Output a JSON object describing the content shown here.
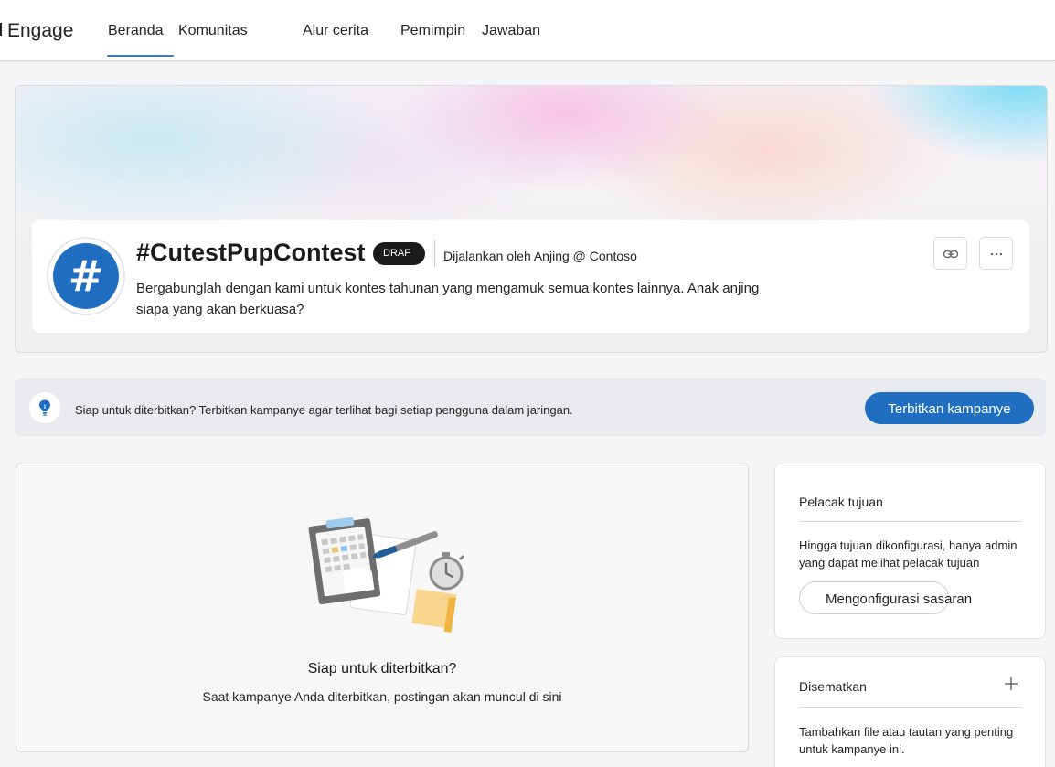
{
  "app": {
    "title": "Engage"
  },
  "nav": {
    "tabs": [
      {
        "label": "Beranda",
        "active": true
      },
      {
        "label": "Komunitas"
      },
      {
        "label": "Alur cerita"
      },
      {
        "label": "Pemimpin"
      },
      {
        "label": "Jawaban"
      }
    ]
  },
  "campaign": {
    "avatar_symbol": "#",
    "title": "#CutestPupContest",
    "badge": "DRAF",
    "run_by": "Dijalankan oleh Anjing @ Contoso",
    "description": "Bergabunglah dengan kami untuk kontes tahunan yang mengamuk semua kontes lainnya. Anak anjing siapa yang akan berkuasa?",
    "actions": {
      "link_icon": "link-icon",
      "more_icon": "more-icon"
    }
  },
  "publish_banner": {
    "icon": "lightbulb-icon",
    "text": "Siap untuk diterbitkan? Terbitkan kampanye agar terlihat bagi setiap pengguna dalam jaringan.",
    "button": "Terbitkan kampanye"
  },
  "feed": {
    "title": "Siap untuk diterbitkan?",
    "subtitle": "Saat kampanye Anda diterbitkan, postingan akan muncul di sini"
  },
  "goal_tracker": {
    "title": "Pelacak tujuan",
    "text": "Hingga tujuan dikonfigurasi, hanya admin yang dapat melihat pelacak tujuan",
    "button": "Mengonfigurasi sasaran"
  },
  "pinned": {
    "title": "Disematkan",
    "add_icon": "plus-icon",
    "text": "Tambahkan file atau tautan yang penting untuk kampanye ini."
  },
  "colors": {
    "accent": "#1f6ec1",
    "badge_bg": "#1b1b1b"
  }
}
